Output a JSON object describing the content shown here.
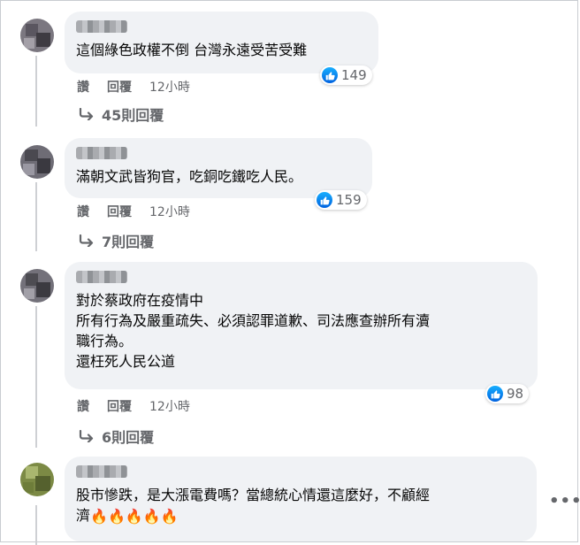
{
  "comments": [
    {
      "text": "這個綠色政權不倒 台灣永遠受苦受難",
      "reactions": "149",
      "actions": {
        "like": "讚",
        "reply": "回覆",
        "time": "12小時"
      },
      "replies": "45則回覆",
      "avatar_colors": [
        "#6c6670",
        "#8a8590",
        "#4e4b52",
        "#a29da6"
      ]
    },
    {
      "text": "滿朝文武皆狗官，吃銅吃鐵吃人民。",
      "reactions": "159",
      "actions": {
        "like": "讚",
        "reply": "回覆",
        "time": "12小時"
      },
      "replies": "7則回覆",
      "avatar_colors": [
        "#5b5a63",
        "#7e7c86",
        "#3f3e45",
        "#9b99a3"
      ]
    },
    {
      "text": "對於蔡政府在疫情中\n所有行為及嚴重疏失、必須認罪道歉、司法應查辦所有瀆\n職行為。\n還枉死人民公道",
      "reactions": "98",
      "actions": {
        "like": "讚",
        "reply": "回覆",
        "time": "12小時"
      },
      "replies": "6則回覆",
      "avatar_colors": [
        "#5e5c62",
        "#85838a",
        "#403f44",
        "#a3a1a7"
      ]
    },
    {
      "text": "股市慘跌，是大漲電費嗎？當總統心情還這麼好，不顧經\n濟",
      "emoji": "🔥🔥🔥🔥🔥",
      "avatar_colors": [
        "#6b7a3a",
        "#8fa050",
        "#55602c",
        "#b4bf7a"
      ]
    }
  ],
  "icons": {
    "like": "thumbs-up-icon",
    "reply_arrow": "reply-arrow-icon",
    "more": "more-options-icon",
    "fire": "fire-emoji"
  },
  "more_label": "•••"
}
